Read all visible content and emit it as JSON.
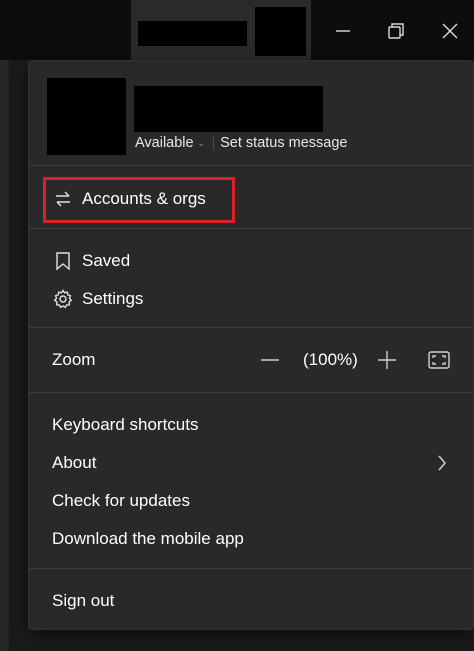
{
  "titlebar": {
    "minimize_icon": "minimize-icon",
    "restore_icon": "restore-icon",
    "close_icon": "close-icon"
  },
  "profile": {
    "status": "Available",
    "set_status": "Set status message"
  },
  "menu": {
    "accounts": {
      "label": "Accounts & orgs",
      "icon": "switch-arrows-icon"
    },
    "saved": {
      "label": "Saved",
      "icon": "bookmark-icon"
    },
    "settings": {
      "label": "Settings",
      "icon": "gear-icon"
    },
    "zoom": {
      "label": "Zoom",
      "value": "(100%)"
    },
    "keyboard_shortcuts": "Keyboard shortcuts",
    "about": "About",
    "check_updates": "Check for updates",
    "download_app": "Download the mobile app",
    "sign_out": "Sign out"
  },
  "colors": {
    "menu_bg": "#292929",
    "highlight_border": "#d9202a",
    "text": "#ffffff"
  }
}
